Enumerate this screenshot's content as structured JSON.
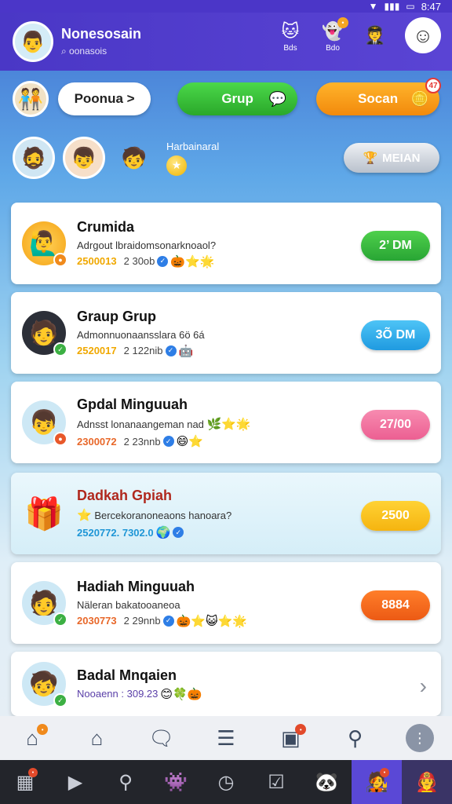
{
  "status_bar": {
    "time": "8:47",
    "signal_icon": "signal-icon",
    "wifi_icon": "wifi-icon",
    "battery_icon": "battery-icon"
  },
  "header": {
    "name": "Nonesosain",
    "subtitle": "⌕ oonasois",
    "actions": [
      {
        "icon": "cat-face-icon",
        "label": "Bds"
      },
      {
        "icon": "ghost-face-icon",
        "label": "Bdo"
      }
    ]
  },
  "pills": {
    "profile_label": "Poonua >",
    "group_label": "Grup",
    "scan_label": "Socan",
    "scan_badge": "47"
  },
  "friends": {
    "label": "Harbainaral",
    "button_label": "MEIAN"
  },
  "cards": [
    {
      "title": "Crumida",
      "desc": "Adrgout lbraidomsonarknoaol?",
      "num": "2500013",
      "count": "2 30ob",
      "button": "2’ DM"
    },
    {
      "title": "Graup Grup",
      "desc": "Admonnuonaansslara 6ö 6á",
      "num": "2520017",
      "count": "2 122nib",
      "button": "3Õ DM"
    },
    {
      "title": "Gpdal Minguuah",
      "desc": "Adnsst lonanaangeman nad",
      "num": "2300072",
      "count": "2 23nnb",
      "button": "27/00"
    },
    {
      "title": "Dadkah Gpiah",
      "desc": "Bercekoranoneaons hanoara?",
      "num": "2520772. 7302.0",
      "count": "",
      "button": "2500"
    },
    {
      "title": "Hadiah Minguuah",
      "desc": "Näleran bakatooaneoa",
      "num": "2030773",
      "count": "2 29nnb",
      "button": "8884"
    },
    {
      "title": "Badal Mnqaien",
      "desc": "",
      "num": "Nooaenn : 309.23",
      "count": "",
      "button": ""
    }
  ],
  "colors": {
    "header": "#4a37c6",
    "green": "#2fb33a",
    "blue": "#2aa8e6",
    "pink": "#f06a9b",
    "orange": "#f7a316",
    "deep_orange": "#ef5f1c"
  }
}
